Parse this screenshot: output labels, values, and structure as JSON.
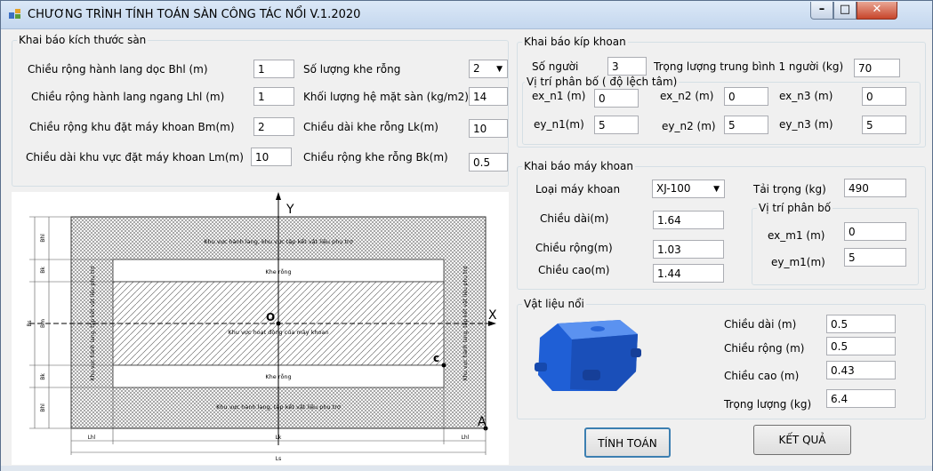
{
  "window": {
    "title": "CHƯƠNG TRÌNH TÍNH TOÁN SÀN CÔNG TÁC NỔI  V.1.2020"
  },
  "san": {
    "legend": "Khai báo kích thước sàn",
    "bhl_label": "Chiều rộng hành lang dọc Bhl (m)",
    "bhl_value": "1",
    "lhl_label": "Chiều rộng hành lang ngang Lhl (m)",
    "lhl_value": "1",
    "bm_label": "Chiều rộng khu đặt máy khoan Bm(m)",
    "bm_value": "2",
    "lm_label": "Chiều dài khu vực đặt máy khoan Lm(m)",
    "lm_value": "10",
    "khe_label": "Số lượng khe rỗng",
    "khe_value": "2",
    "kl_label": "Khối lượng hệ mặt sàn (kg/m2)",
    "kl_value": "14",
    "lk_label": "Chiều dài khe rỗng Lk(m)",
    "lk_value": "10",
    "bk_label": "Chiều rộng khe rỗng Bk(m)",
    "bk_value": "0.5"
  },
  "kip": {
    "legend": "Khai báo kíp khoan",
    "songuoi_label": "Số người",
    "songuoi_value": "3",
    "trongluong_label": "Trọng lượng trung bình 1 người (kg)",
    "trongluong_value": "70",
    "vitri_legend": "Vị trí phân bố ( độ lệch tâm)",
    "ex_n1_label": "ex_n1 (m)",
    "ex_n1_value": "0",
    "ex_n2_label": "ex_n2 (m)",
    "ex_n2_value": "0",
    "ex_n3_label": "ex_n3 (m)",
    "ex_n3_value": "0",
    "ey_n1_label": "ey_n1(m)",
    "ey_n1_value": "5",
    "ey_n2_label": "ey_n2 (m)",
    "ey_n2_value": "5",
    "ey_n3_label": "ey_n3 (m)",
    "ey_n3_value": "5"
  },
  "may": {
    "legend": "Khai báo máy khoan",
    "loai_label": "Loại máy khoan",
    "loai_value": "XJ-100",
    "taitrong_label": "Tải trọng (kg)",
    "taitrong_value": "490",
    "dai_label": "Chiều dài(m)",
    "dai_value": "1.64",
    "rong_label": "Chiều rộng(m)",
    "rong_value": "1.03",
    "cao_label": "Chiều cao(m)",
    "cao_value": "1.44",
    "vitri_legend": "Vị trí phân bố",
    "ex_m1_label": "ex_m1 (m)",
    "ex_m1_value": "0",
    "ey_m1_label": "ey_m1(m)",
    "ey_m1_value": "5"
  },
  "vatlieu": {
    "legend": "Vật liệu nổi",
    "dai_label": "Chiều dài (m)",
    "dai_value": "0.5",
    "rong_label": "Chiều rộng (m)",
    "rong_value": "0.5",
    "cao_label": "Chiều cao (m)",
    "cao_value": "0.43",
    "trongluong_label": "Trọng lượng (kg)",
    "trongluong_value": "6.4"
  },
  "buttons": {
    "tinh_toan": "TÍNH TOÁN",
    "ket_qua": "KẾT QUẢ"
  },
  "diagram": {
    "y_axis": "Y",
    "x_axis": "X",
    "origin": "O",
    "point_c": "c",
    "point_a": "A",
    "top_corridor": "Khu vực hành lang, khu vực tập kết vật liệu phụ trợ",
    "bottom_corridor": "Khu vực hành lang, tập kết vật liệu phụ trợ",
    "slot": "Khe rỗng",
    "work_zone": "Khu vực hoạt động của máy khoan",
    "side_left": "Khu vực hành lang, tập kết vật liệu phụ trợ",
    "side_right": "Khu vực hành lang, tập kết vật liệu phụ trợ",
    "dim_lhl": "Lhl",
    "dim_lk": "Lk",
    "dim_ls": "Ls",
    "dim_bhl": "Bhl",
    "dim_bk": "Bk",
    "dim_bm": "Bm",
    "dim_bs": "Bs"
  },
  "colors": {
    "float_blue": "#1f5fd6",
    "focus_border": "#3c7fb1"
  }
}
